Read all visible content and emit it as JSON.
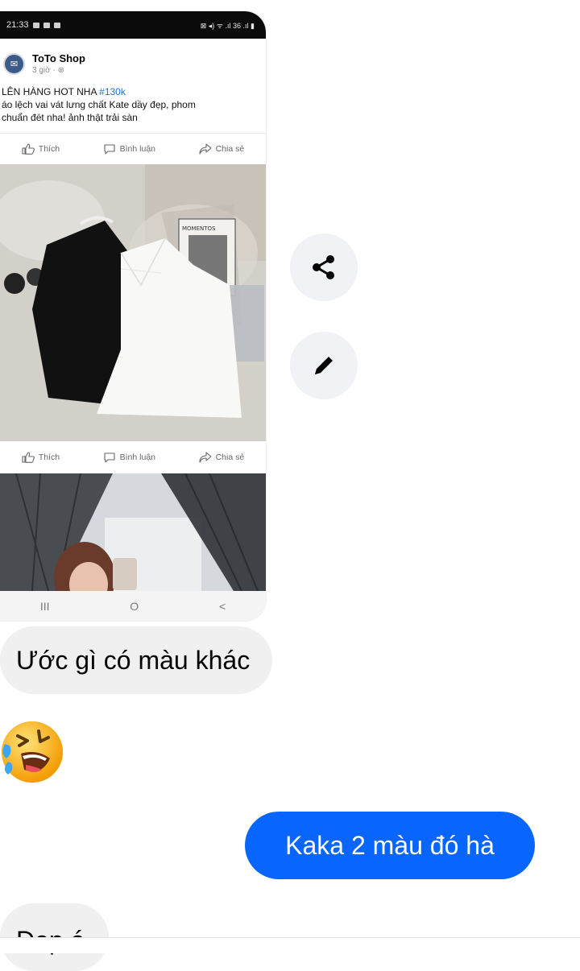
{
  "shared_post": {
    "status_bar": {
      "time": "21:33",
      "right_text": "⊠ ◂) ᯤ .ıl 36 .ıl ▮"
    },
    "page_name": "ToTo Shop",
    "post_meta": "3 giờ · ⊕",
    "text_line1_prefix": "LÊN HÀNG HOT NHA ",
    "hashtag": "#130k",
    "text_line2": "áo lệch vai vát lưng chất Kate dầy đẹp, phom",
    "text_line3": "chuẩn đét nha! ảnh thật trải sàn",
    "actions": {
      "like": "Thích",
      "comment": "Bình luận",
      "share": "Chia sẻ"
    },
    "photo_label": "MOMENTOS",
    "nav": {
      "recents": "III",
      "home": "O",
      "back": "<"
    }
  },
  "side_actions": {
    "share_icon": "share-icon",
    "edit_icon": "pencil-icon"
  },
  "messages": [
    {
      "from": "them",
      "text": "Ước gì có màu khác"
    },
    {
      "from": "them",
      "text": "🤣",
      "type": "emoji"
    },
    {
      "from": "me",
      "text": "Kaka 2 màu đó hà"
    },
    {
      "from": "them",
      "text": "Đẹp á"
    }
  ],
  "colors": {
    "outgoing_bubble": "#0866ff",
    "incoming_bubble": "#f0f0f0",
    "hashtag": "#216fdb"
  }
}
